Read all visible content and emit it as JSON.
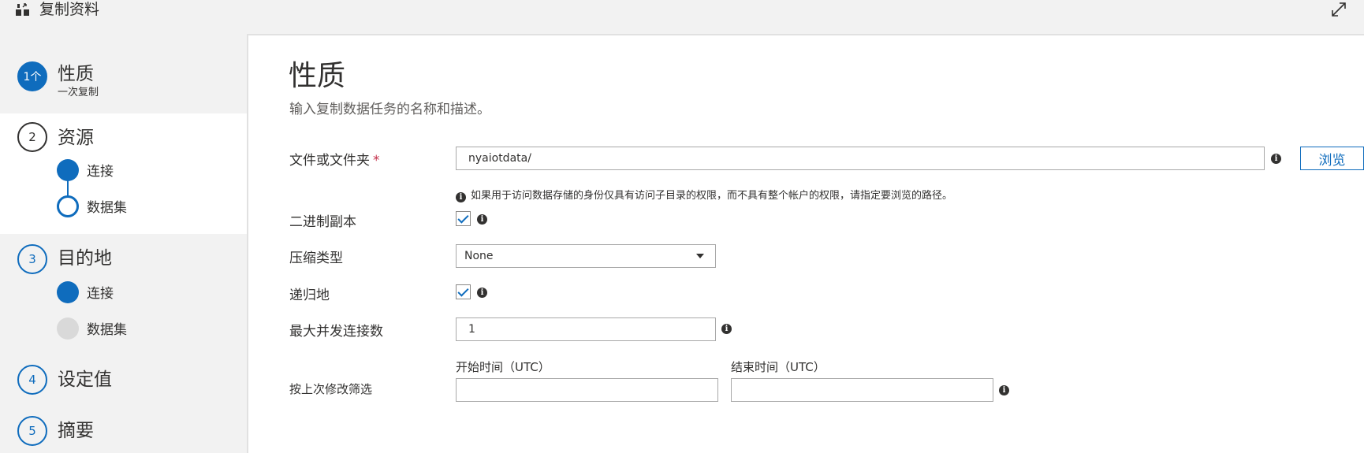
{
  "app": {
    "title": "复制资料",
    "icon": "copy-data-icon",
    "expand_icon": "expand-icon"
  },
  "sidebar": {
    "steps": [
      {
        "number": "1个",
        "label": "性质",
        "sublabel": "一次复制",
        "state": "current"
      },
      {
        "number": "2",
        "label": "资源",
        "substeps": [
          {
            "label": "连接",
            "state": "complete"
          },
          {
            "label": "数据集",
            "state": "current"
          }
        ]
      },
      {
        "number": "3",
        "label": "目的地",
        "substeps": [
          {
            "label": "连接",
            "state": "complete"
          },
          {
            "label": "数据集",
            "state": "pending"
          }
        ]
      },
      {
        "number": "4",
        "label": "设定值"
      },
      {
        "number": "5",
        "label": "摘要"
      }
    ]
  },
  "main": {
    "title": "性质",
    "description": "输入复制数据任务的名称和描述。",
    "file_or_folder": {
      "label": "文件或文件夹",
      "required_mark": "*",
      "value": "nyaiotdata/",
      "browse_label": "浏览",
      "hint": "如果用于访问数据存储的身份仅具有访问子目录的权限，而不具有整个帐户的权限，请指定要浏览的路径。"
    },
    "binary_copy": {
      "label": "二进制副本",
      "checked": true
    },
    "compression_type": {
      "label": "压缩类型",
      "value": "None"
    },
    "recursively": {
      "label": "递归地",
      "checked": true
    },
    "max_concurrent": {
      "label": "最大并发连接数",
      "value": "1"
    },
    "filter_last_modified": {
      "label": "按上次修改筛选",
      "start_label": "开始时间（UTC）",
      "end_label": "结束时间（UTC）",
      "start_value": "",
      "end_value": ""
    },
    "info_glyph": "i"
  },
  "colors": {
    "accent": "#0f6cbd",
    "required": "#c4314b",
    "sidebar_bg": "#f2f2f2",
    "panel_bg": "#ffffff"
  }
}
